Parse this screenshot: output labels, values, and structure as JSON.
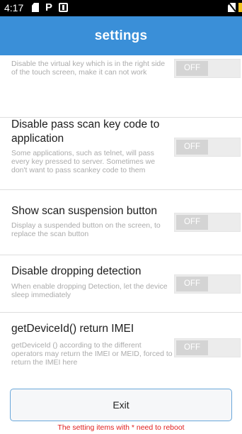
{
  "status_bar": {
    "time": "4:17",
    "icons": [
      "document-icon",
      "parking-icon",
      "sim-card-icon",
      "no-sim-icon",
      "battery-icon"
    ]
  },
  "app_bar": {
    "title": "settings"
  },
  "settings": {
    "items": [
      {
        "title": "",
        "description": "Disable the virtual key which is in the right side of the touch screen, make it can not work",
        "toggle": "OFF"
      },
      {
        "title": "Disable pass scan key code to application",
        "description": "Some applications, such as telnet, will pass every key pressed to server. Sometimes we don't want to pass scankey code to them",
        "toggle": "OFF"
      },
      {
        "title": "Show scan suspension button",
        "description": "Display a suspended button on the screen, to replace the scan button",
        "toggle": "OFF"
      },
      {
        "title": "Disable dropping detection",
        "description": "When enable dropping Detection, let the device sleep immediately",
        "toggle": "OFF"
      },
      {
        "title": "getDeviceId() return IMEI",
        "description": "getDeviceId () according to the different operators may return the IMEI or MEID, forced to return the IMEI here",
        "toggle": "OFF"
      }
    ]
  },
  "footer": {
    "exit_label": "Exit",
    "reboot_note": "The setting items with * need to reboot",
    "note_color": "#e01e1e"
  },
  "colors": {
    "accent": "#3a8fd8",
    "toggle_knob": "#d4d4d4"
  }
}
